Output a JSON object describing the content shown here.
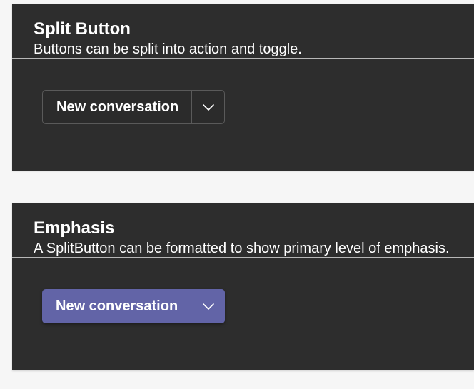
{
  "sections": [
    {
      "title": "Split Button",
      "description": "Buttons can be split into action and toggle.",
      "button": {
        "label": "New conversation",
        "toggle_icon": "chevron-down-icon",
        "variant": "default"
      }
    },
    {
      "title": "Emphasis",
      "description": "A SplitButton can be formatted to show primary level of emphasis.",
      "button": {
        "label": "New conversation",
        "toggle_icon": "chevron-down-icon",
        "variant": "primary"
      }
    }
  ],
  "colors": {
    "page_background": "#f6f6f6",
    "card_background": "#2d2d2d",
    "primary_accent": "#6264a7",
    "text": "#ffffff"
  }
}
